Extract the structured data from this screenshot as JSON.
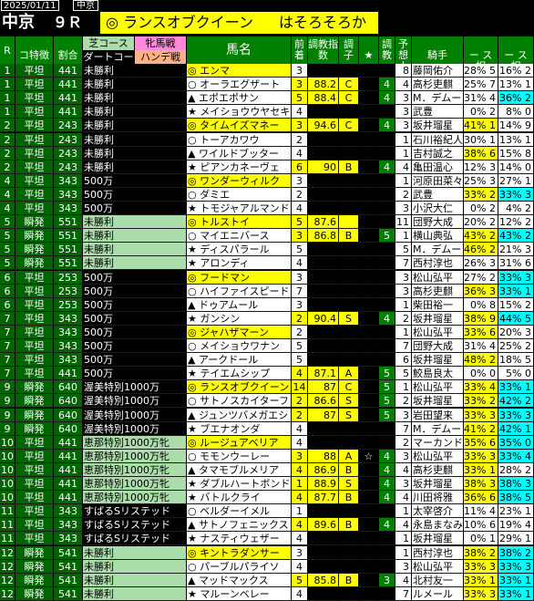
{
  "header": {
    "date": "2025/01/11",
    "venue_small": "中京",
    "venue": "中京",
    "race_no": "９Ｒ",
    "mark": "◎",
    "top_horse": "ランスオブクイーン",
    "comment": "はそろそろか"
  },
  "columns": {
    "r": "R",
    "course": "コ特徴",
    "ratio": "割合",
    "turf": "芝コース",
    "dirt": "ダートコー",
    "fm": "牝馬戦",
    "handi": "ハンデ戦",
    "horse": "馬名",
    "prev": "前着",
    "chokyo": "調教指数",
    "cho_state": "調子",
    "star": "★",
    "cho": "調教",
    "pred": "予想人気",
    "jockey_top": "騎手",
    "jockey": "騎手",
    "trainer": "調教師",
    "j_ai": "ー ス 相",
    "t_ai": "ー ス 相"
  },
  "colors": {
    "green": "#008000",
    "dgreen": "#006400",
    "lgreen": "#aaddaa",
    "salmon": "#ffb088",
    "yellow": "#ffff00",
    "cyan": "#00ffff",
    "pink": "#ff88dd"
  },
  "rows": [
    {
      "r": "1",
      "course": "平坦",
      "ratio": "441",
      "cls": "未勝利",
      "mark": "◎",
      "name": "エンマ",
      "prev": "3",
      "idx": "",
      "st": "",
      "star": "",
      "cho": "",
      "pred": "8",
      "jockey": "藤岡佑介",
      "jr": "28%",
      "jn": "5",
      "tr": "16%",
      "tn": "2"
    },
    {
      "r": "1",
      "course": "平坦",
      "ratio": "441",
      "cls": "未勝利",
      "mark": "○",
      "name": "オーラエグザート",
      "prev": "3",
      "idx": "88.2",
      "st": "C",
      "star": "",
      "cho": "4",
      "pred": "4",
      "jockey": "高杉吏麒",
      "jr": "25%",
      "jn": "7",
      "tr": "13%",
      "tn": "1"
    },
    {
      "r": "1",
      "course": "平坦",
      "ratio": "441",
      "cls": "未勝利",
      "mark": "▲",
      "name": "エポエポサン",
      "prev": "5",
      "idx": "88.4",
      "st": "C",
      "star": "",
      "cho": "4",
      "pred": "3",
      "jockey": "M．デムー",
      "jr": "31%",
      "jn": "4",
      "tr": "36%",
      "tn": "2"
    },
    {
      "r": "1",
      "course": "平坦",
      "ratio": "441",
      "cls": "未勝利",
      "mark": "★",
      "name": "メイショウウヤセキ",
      "prev": "4",
      "idx": "",
      "st": "",
      "star": "",
      "cho": "",
      "pred": "3",
      "jockey": "武豊",
      "jr": "0%",
      "jn": "2",
      "tr": "8%",
      "tn": "0"
    },
    {
      "r": "2",
      "course": "平坦",
      "ratio": "243",
      "cls": "未勝利",
      "mark": "◎",
      "name": "タイムイズマネー",
      "prev": "3",
      "idx": "94.6",
      "st": "C",
      "star": "",
      "cho": "4",
      "pred": "3",
      "jockey": "坂井瑠星",
      "jr": "41%",
      "jn": "1",
      "tr": "14%",
      "tn": "9"
    },
    {
      "r": "2",
      "course": "平坦",
      "ratio": "243",
      "cls": "未勝利",
      "mark": "○",
      "name": "トーアカワウ",
      "prev": "2",
      "idx": "",
      "st": "",
      "star": "",
      "cho": "",
      "pred": "1",
      "jockey": "石川裕紀人",
      "jr": "30%",
      "jn": "1",
      "tr": "13%",
      "tn": "1"
    },
    {
      "r": "2",
      "course": "平坦",
      "ratio": "243",
      "cls": "未勝利",
      "mark": "▲",
      "name": "ワイルドブッター",
      "prev": "4",
      "idx": "",
      "st": "",
      "star": "",
      "cho": "",
      "pred": "1",
      "jockey": "吉村誠之",
      "jr": "38%",
      "jn": "6",
      "tr": "15%",
      "tn": "8"
    },
    {
      "r": "2",
      "course": "平坦",
      "ratio": "243",
      "cls": "未勝利",
      "mark": "★",
      "name": "ピアンカネーヴェ",
      "prev": "6",
      "idx": "90",
      "st": "B",
      "star": "",
      "cho": "4",
      "pred": "4",
      "jockey": "亀田温心",
      "jr": "12%",
      "jn": "3",
      "tr": "14%",
      "tn": "0"
    },
    {
      "r": "4",
      "course": "平坦",
      "ratio": "343",
      "cls": "500万",
      "mark": "◎",
      "name": "ワンダーウィルク",
      "prev": "3",
      "idx": "",
      "st": "",
      "star": "",
      "cho": "",
      "pred": "1",
      "jockey": "河原田菜々",
      "jr": "25%",
      "jn": "3",
      "tr": "27%",
      "tn": "1"
    },
    {
      "r": "4",
      "course": "平坦",
      "ratio": "343",
      "cls": "500万",
      "mark": "○",
      "name": "ダミエ",
      "prev": "2",
      "idx": "",
      "st": "",
      "star": "",
      "cho": "",
      "pred": "2",
      "jockey": "武豊",
      "jr": "33%",
      "jn": "2",
      "tr": "33%",
      "tn": "3"
    },
    {
      "r": "4",
      "course": "平坦",
      "ratio": "343",
      "cls": "500万",
      "mark": "★",
      "name": "トモジャアルマンド",
      "prev": "4",
      "idx": "",
      "st": "",
      "star": "",
      "cho": "",
      "pred": "3",
      "jockey": "小沢大仁",
      "jr": "0%",
      "jn": "2",
      "tr": "4%",
      "tn": "2"
    },
    {
      "r": "5",
      "course": "瞬発",
      "ratio": "551",
      "cls": "未勝利",
      "mark": "◎",
      "name": "トルストイ",
      "prev": "5",
      "idx": "87.6",
      "st": "",
      "star": "",
      "cho": "",
      "pred": "11",
      "jockey": "団野大成",
      "jr": "20%",
      "jn": "2",
      "tr": "12%",
      "tn": "2"
    },
    {
      "r": "5",
      "course": "瞬発",
      "ratio": "551",
      "cls": "未勝利",
      "mark": "○",
      "name": "マイエニバース",
      "prev": "3",
      "idx": "86.8",
      "st": "B",
      "star": "",
      "cho": "5",
      "pred": "1",
      "jockey": "横山典弘",
      "jr": "43%",
      "jn": "2",
      "tr": "43%",
      "tn": "2"
    },
    {
      "r": "5",
      "course": "瞬発",
      "ratio": "551",
      "cls": "未勝利",
      "mark": "★",
      "name": "ディスパラール",
      "prev": "5",
      "idx": "",
      "st": "",
      "star": "",
      "cho": "",
      "pred": "5",
      "jockey": "M．デムー",
      "jr": "46%",
      "jn": "2",
      "tr": "21%",
      "tn": "3"
    },
    {
      "r": "5",
      "course": "瞬発",
      "ratio": "551",
      "cls": "未勝利",
      "mark": "★",
      "name": "アロンディ",
      "prev": "4",
      "idx": "",
      "st": "",
      "star": "",
      "cho": "",
      "pred": "7",
      "jockey": "西村淳也",
      "jr": "26%",
      "jn": "3",
      "tr": "31%",
      "tn": "6"
    },
    {
      "r": "6",
      "course": "平坦",
      "ratio": "253",
      "cls": "500万",
      "mark": "◎",
      "name": "フードマン",
      "prev": "3",
      "idx": "",
      "st": "",
      "star": "",
      "cho": "",
      "pred": "3",
      "jockey": "松山弘平",
      "jr": "27%",
      "jn": "2",
      "tr": "33%",
      "tn": "3"
    },
    {
      "r": "6",
      "course": "平坦",
      "ratio": "253",
      "cls": "500万",
      "mark": "○",
      "name": "ハイファイスピード",
      "prev": "7",
      "idx": "",
      "st": "",
      "star": "",
      "cho": "",
      "pred": "3",
      "jockey": "高杉吏麒",
      "jr": "36%",
      "jn": "3",
      "tr": "33%",
      "tn": "1"
    },
    {
      "r": "6",
      "course": "平坦",
      "ratio": "253",
      "cls": "500万",
      "mark": "▲",
      "name": "ドゥアムール",
      "prev": "3",
      "idx": "",
      "st": "",
      "star": "",
      "cho": "",
      "pred": "1",
      "jockey": "柴田裕一",
      "jr": "0%",
      "jn": "8",
      "tr": "15%",
      "tn": "2"
    },
    {
      "r": "7",
      "course": "平坦",
      "ratio": "343",
      "cls": "500万",
      "mark": "★",
      "name": "ガンシン",
      "prev": "2",
      "idx": "90.4",
      "st": "S",
      "star": "",
      "cho": "4",
      "pred": "2",
      "jockey": "坂井瑠星",
      "jr": "38%",
      "jn": "9",
      "tr": "44%",
      "tn": "5"
    },
    {
      "r": "7",
      "course": "平坦",
      "ratio": "343",
      "cls": "500万",
      "mark": "◎",
      "name": "ジャハザマーン",
      "prev": "2",
      "idx": "",
      "st": "",
      "star": "",
      "cho": "",
      "pred": "1",
      "jockey": "松山弘平",
      "jr": "33%",
      "jn": "6",
      "tr": "20%",
      "tn": "3"
    },
    {
      "r": "7",
      "course": "平坦",
      "ratio": "343",
      "cls": "500万",
      "mark": "○",
      "name": "メイショウワナン",
      "prev": "5",
      "idx": "",
      "st": "",
      "star": "",
      "cho": "",
      "pred": "7",
      "jockey": "団野大成",
      "jr": "31%",
      "jn": "4",
      "tr": "25%",
      "tn": "2"
    },
    {
      "r": "7",
      "course": "平坦",
      "ratio": "343",
      "cls": "500万",
      "mark": "▲",
      "name": "アークドール",
      "prev": "5",
      "idx": "",
      "st": "",
      "star": "",
      "cho": "",
      "pred": "6",
      "jockey": "坂井瑠星",
      "jr": "48%",
      "jn": "2",
      "tr": "18%",
      "tn": "5"
    },
    {
      "r": "7",
      "course": "平坦",
      "ratio": "441",
      "cls": "500万",
      "mark": "★",
      "name": "テイエムシップ",
      "prev": "4",
      "idx": "87.1",
      "st": "A",
      "star": "",
      "cho": "5",
      "pred": "5",
      "jockey": "鮫島良太",
      "jr": "0%",
      "jn": "0",
      "tr": "5%",
      "tn": "0"
    },
    {
      "r": "9",
      "course": "瞬発",
      "ratio": "640",
      "cls": "渥美特別1000万",
      "mark": "◎",
      "name": "ランスオブクイーン",
      "prev": "14",
      "idx": "87",
      "st": "C",
      "star": "",
      "cho": "5",
      "pred": "1",
      "jockey": "松山弘平",
      "jr": "33%",
      "jn": "4",
      "tr": "33%",
      "tn": "1"
    },
    {
      "r": "9",
      "course": "瞬発",
      "ratio": "640",
      "cls": "渥美特別1000万",
      "mark": "○",
      "name": "サトノスカイターフ",
      "prev": "2",
      "idx": "86.6",
      "st": "S",
      "star": "",
      "cho": "5",
      "pred": "2",
      "jockey": "坂井瑠星",
      "jr": "33%",
      "jn": "2",
      "tr": "42%",
      "tn": "2"
    },
    {
      "r": "9",
      "course": "瞬発",
      "ratio": "640",
      "cls": "渥美特別1000万",
      "mark": "▲",
      "name": "ジュンツバメガエシ",
      "prev": "2",
      "idx": "87",
      "st": "S",
      "star": "",
      "cho": "5",
      "pred": "3",
      "jockey": "岩田望来",
      "jr": "33%",
      "jn": "3",
      "tr": "33%",
      "tn": "3"
    },
    {
      "r": "9",
      "course": "瞬発",
      "ratio": "640",
      "cls": "渥美特別1000万",
      "mark": "★",
      "name": "ブエナオンダ",
      "prev": "4",
      "idx": "",
      "st": "",
      "star": "",
      "cho": "",
      "pred": "7",
      "jockey": "M．デムー",
      "jr": "41%",
      "jn": "2",
      "tr": "42%",
      "tn": "1"
    },
    {
      "r": "10",
      "course": "平坦",
      "ratio": "441",
      "cls": "恵那特別1000万牝",
      "mark": "◎",
      "name": "ルージュアベリア",
      "prev": "4",
      "idx": "",
      "st": "",
      "star": "",
      "cho": "",
      "pred": "2",
      "jockey": "マーカンド",
      "jr": "35%",
      "jn": "6",
      "tr": "35%",
      "tn": "0"
    },
    {
      "r": "10",
      "course": "平坦",
      "ratio": "441",
      "cls": "恵那特別1000万牝",
      "mark": "○",
      "name": "モモンウーレー",
      "prev": "3",
      "idx": "88",
      "st": "A",
      "star": "☆",
      "cho": "4",
      "pred": "3",
      "jockey": "松山弘平",
      "jr": "33%",
      "jn": "3",
      "tr": "33%",
      "tn": "4"
    },
    {
      "r": "10",
      "course": "平坦",
      "ratio": "441",
      "cls": "恵那特別1000万牝",
      "mark": "▲",
      "name": "タマモブルメリア",
      "prev": "4",
      "idx": "86.9",
      "st": "B",
      "star": "",
      "cho": "4",
      "pred": "4",
      "jockey": "高杉吏麒",
      "jr": "33%",
      "jn": "1",
      "tr": "28%",
      "tn": "2"
    },
    {
      "r": "10",
      "course": "平坦",
      "ratio": "441",
      "cls": "恵那特別1000万牝",
      "mark": "★",
      "name": "ダブルハートボンド",
      "prev": "1",
      "idx": "88.9",
      "st": "S",
      "star": "",
      "cho": "4",
      "pred": "3",
      "jockey": "坂井瑠星",
      "jr": "38%",
      "jn": "3",
      "tr": "38%",
      "tn": "3"
    },
    {
      "r": "10",
      "course": "平坦",
      "ratio": "441",
      "cls": "恵那特別1000万牝",
      "mark": "★",
      "name": "バトルクライ",
      "prev": "4",
      "idx": "87.7",
      "st": "B",
      "star": "",
      "cho": "4",
      "pred": "4",
      "jockey": "川田将雅",
      "jr": "36%",
      "jn": "6",
      "tr": "38%",
      "tn": "5"
    },
    {
      "r": "11",
      "course": "平坦",
      "ratio": "343",
      "cls": "すばるSリステッド",
      "mark": "○",
      "name": "ベルダーイメル",
      "prev": "1",
      "idx": "",
      "st": "",
      "star": "",
      "cho": "",
      "pred": "1",
      "jockey": "太宰啓介",
      "jr": "11%",
      "jn": "4",
      "tr": "23%",
      "tn": "1"
    },
    {
      "r": "11",
      "course": "平坦",
      "ratio": "343",
      "cls": "すばるSリステッド",
      "mark": "▲",
      "name": "サトノフェニックス",
      "prev": "4",
      "idx": "89.6",
      "st": "B",
      "star": "",
      "cho": "4",
      "pred": "4",
      "jockey": "永島まなみ",
      "jr": "10%",
      "jn": "6",
      "tr": "19%",
      "tn": "4"
    },
    {
      "r": "11",
      "course": "平坦",
      "ratio": "343",
      "cls": "すばるSリステッド",
      "mark": "★",
      "name": "ナスティウェザー",
      "prev": "4",
      "idx": "",
      "st": "",
      "star": "",
      "cho": "",
      "pred": "1",
      "jockey": "坂井瑠星",
      "jr": "0%",
      "jn": "1",
      "tr": "29%",
      "tn": "1"
    },
    {
      "r": "12",
      "course": "瞬発",
      "ratio": "541",
      "cls": "未勝利",
      "mark": "◎",
      "name": "キントラダンサー",
      "prev": "3",
      "idx": "",
      "st": "",
      "star": "",
      "cho": "",
      "pred": "1",
      "jockey": "西村淳也",
      "jr": "38%",
      "jn": "2",
      "tr": "38%",
      "tn": "2"
    },
    {
      "r": "12",
      "course": "瞬発",
      "ratio": "541",
      "cls": "未勝利",
      "mark": "○",
      "name": "パーブルパライソ",
      "prev": "4",
      "idx": "",
      "st": "",
      "star": "",
      "cho": "",
      "pred": "3",
      "jockey": "松山弘平",
      "jr": "33%",
      "jn": "3",
      "tr": "33%",
      "tn": "3"
    },
    {
      "r": "12",
      "course": "瞬発",
      "ratio": "541",
      "cls": "未勝利",
      "mark": "▲",
      "name": "マッドマックス",
      "prev": "5",
      "idx": "85.8",
      "st": "B",
      "star": "",
      "cho": "3",
      "pred": "4",
      "jockey": "北村友一",
      "jr": "33%",
      "jn": "1",
      "tr": "33%",
      "tn": "1"
    },
    {
      "r": "12",
      "course": "瞬発",
      "ratio": "541",
      "cls": "未勝利",
      "mark": "★",
      "name": "マルーンベレー",
      "prev": "4",
      "idx": "",
      "st": "",
      "star": "",
      "cho": "",
      "pred": "7",
      "jockey": "ルメール",
      "jr": "33%",
      "jn": "3",
      "tr": "33%",
      "tn": "1"
    }
  ]
}
